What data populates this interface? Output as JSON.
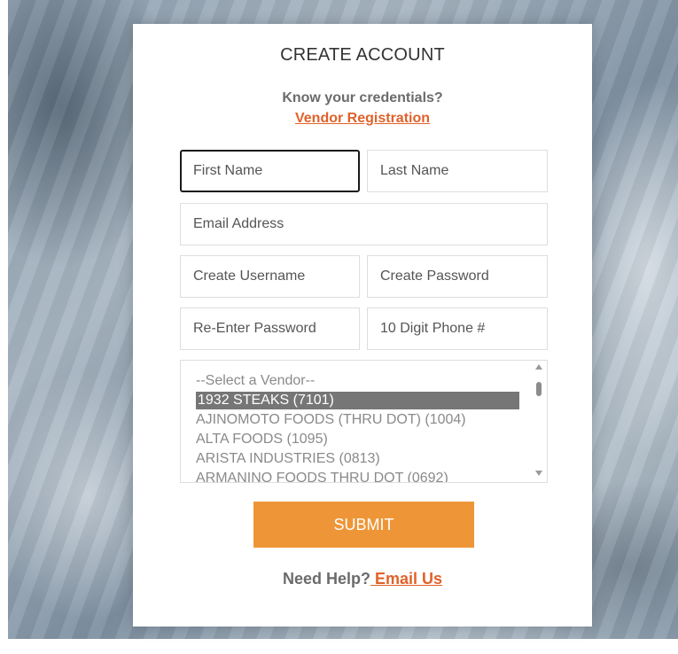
{
  "form": {
    "title": "CREATE ACCOUNT",
    "subtitle": "Know your credentials?",
    "vendor_registration_link": "Vendor Registration",
    "fields": {
      "first_name": {
        "placeholder": "First Name",
        "value": ""
      },
      "last_name": {
        "placeholder": "Last Name",
        "value": ""
      },
      "email": {
        "placeholder": "Email Address",
        "value": ""
      },
      "username": {
        "placeholder": "Create Username",
        "value": ""
      },
      "password": {
        "placeholder": "Create Password",
        "value": ""
      },
      "password_confirm": {
        "placeholder": "Re-Enter Password",
        "value": ""
      },
      "phone": {
        "placeholder": "10 Digit Phone #",
        "value": ""
      }
    },
    "vendor_select": {
      "options": [
        "--Select a Vendor--",
        "1932 STEAKS (7101)",
        "AJINOMOTO FOODS (THRU DOT) (1004)",
        "ALTA FOODS (1095)",
        "ARISTA INDUSTRIES (0813)",
        "ARMANINO FOODS THRU DOT (0692)"
      ],
      "selected": "1932 STEAKS (7101)"
    },
    "submit_label": "SUBMIT",
    "help_text": "Need Help?",
    "help_link": " Email Us"
  },
  "colors": {
    "accent_link": "#e0622a",
    "submit_bg": "#ee9637",
    "selected_option_bg": "#767676"
  }
}
